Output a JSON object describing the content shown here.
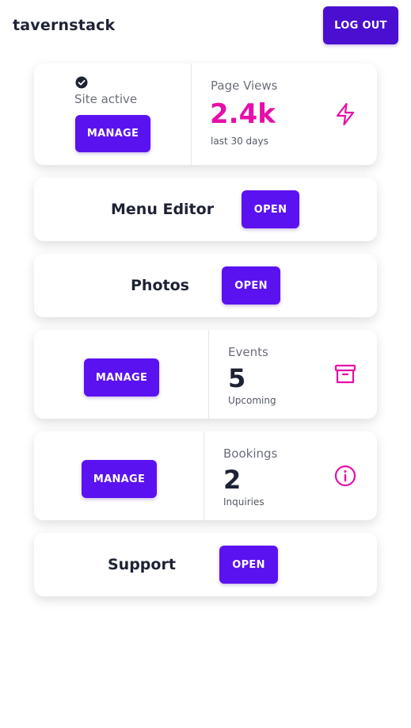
{
  "header": {
    "brand": "tavernstack",
    "logout_label": "LOG OUT"
  },
  "site_card": {
    "status_text": "Site active",
    "manage_label": "MANAGE",
    "stat_label": "Page Views",
    "stat_value": "2.4k",
    "stat_sub": "last 30 days",
    "icon": "lightning-icon"
  },
  "menu_card": {
    "title": "Menu Editor",
    "open_label": "OPEN"
  },
  "photos_card": {
    "title": "Photos",
    "open_label": "OPEN"
  },
  "events_card": {
    "manage_label": "MANAGE",
    "stat_label": "Events",
    "stat_value": "5",
    "stat_sub": "Upcoming",
    "icon": "archive-icon"
  },
  "bookings_card": {
    "manage_label": "MANAGE",
    "stat_label": "Bookings",
    "stat_value": "2",
    "stat_sub": "Inquiries",
    "icon": "info-icon"
  },
  "support_card": {
    "title": "Support",
    "open_label": "OPEN"
  },
  "colors": {
    "primary": "#5b12f0",
    "accent": "#e510a8",
    "text": "#1e2235"
  }
}
